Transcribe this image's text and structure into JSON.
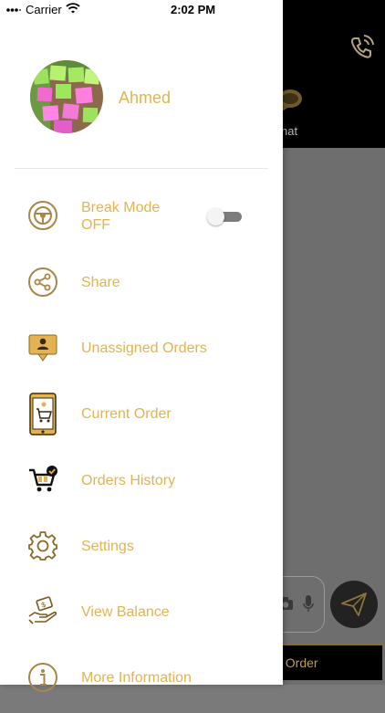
{
  "status_bar": {
    "carrier": "Carrier",
    "time": "2:02 PM"
  },
  "profile": {
    "name": "Ahmed"
  },
  "menu": {
    "break_mode": {
      "label": "Break Mode",
      "state": "OFF",
      "toggle_on": false
    },
    "share": "Share",
    "unassigned_orders": "Unassigned Orders",
    "current_order": "Current Order",
    "orders_history": "Orders History",
    "settings": "Settings",
    "view_balance": "View Balance",
    "more_information": "More Information"
  },
  "background": {
    "chat_label": "hat",
    "cancel_label": "el Order"
  },
  "colors": {
    "accent": "#E2B350",
    "drawer_bg": "#FFFFFF",
    "header_bg": "#000000"
  }
}
